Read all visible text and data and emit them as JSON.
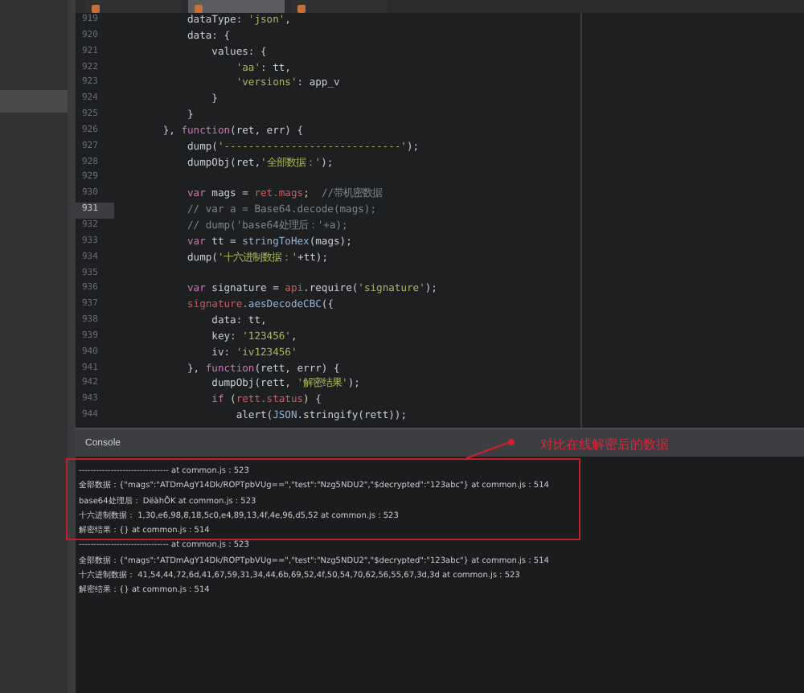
{
  "editor": {
    "tabs": [
      {
        "selected": false
      },
      {
        "selected": true
      },
      {
        "selected": false
      }
    ],
    "lines": [
      {
        "number": "919",
        "current": false,
        "tokens": [
          {
            "kind": "plain",
            "t": "            dataType: "
          },
          {
            "kind": "str",
            "t": "'json'"
          },
          {
            "kind": "plain",
            "t": ","
          }
        ]
      },
      {
        "number": "920",
        "current": false,
        "tokens": [
          {
            "kind": "plain",
            "t": "            data: {"
          }
        ]
      },
      {
        "number": "921",
        "current": false,
        "tokens": [
          {
            "kind": "plain",
            "t": "                values: {"
          }
        ]
      },
      {
        "number": "922",
        "current": false,
        "tokens": [
          {
            "kind": "str",
            "t": "                    'aa'"
          },
          {
            "kind": "plain",
            "t": ": tt,"
          }
        ]
      },
      {
        "number": "923",
        "current": false,
        "tokens": [
          {
            "kind": "str",
            "t": "                    'versions'"
          },
          {
            "kind": "plain",
            "t": ": app_v"
          }
        ]
      },
      {
        "number": "924",
        "current": false,
        "tokens": [
          {
            "kind": "plain",
            "t": "                }"
          }
        ]
      },
      {
        "number": "925",
        "current": false,
        "tokens": [
          {
            "kind": "plain",
            "t": "            }"
          }
        ]
      },
      {
        "number": "926",
        "current": false,
        "tokens": [
          {
            "kind": "plain",
            "t": "        }, "
          },
          {
            "kind": "kw",
            "t": "function"
          },
          {
            "kind": "plain",
            "t": "(ret, err) {"
          }
        ]
      },
      {
        "number": "927",
        "current": false,
        "tokens": [
          {
            "kind": "plain",
            "t": "            dump("
          },
          {
            "kind": "str",
            "t": "'-----------------------------'"
          },
          {
            "kind": "plain",
            "t": ");"
          }
        ]
      },
      {
        "number": "928",
        "current": false,
        "tokens": [
          {
            "kind": "plain",
            "t": "            dumpObj(ret,"
          },
          {
            "kind": "str",
            "t": "'全部数据：'"
          },
          {
            "kind": "plain",
            "t": ");"
          }
        ]
      },
      {
        "number": "929",
        "current": false
      },
      {
        "number": "930",
        "current": false,
        "tokens": [
          {
            "kind": "kw",
            "t": "            var"
          },
          {
            "kind": "plain",
            "t": " mags = "
          },
          {
            "kind": "ref",
            "t": "ret.mags"
          },
          {
            "kind": "plain",
            "t": ";  "
          },
          {
            "kind": "comment",
            "t": "//带机密数据"
          }
        ]
      },
      {
        "number": "931",
        "current": true,
        "tokens": [
          {
            "kind": "comment",
            "t": "            // var a = Base64.decode(mags);"
          }
        ]
      },
      {
        "number": "932",
        "current": false,
        "tokens": [
          {
            "kind": "comment",
            "t": "            // dump('base64处理后：'+a);"
          }
        ]
      },
      {
        "number": "933",
        "current": false,
        "tokens": [
          {
            "kind": "kw",
            "t": "            var"
          },
          {
            "kind": "plain",
            "t": " tt = "
          },
          {
            "kind": "fn",
            "t": "stringToHex"
          },
          {
            "kind": "plain",
            "t": "(mags);"
          }
        ]
      },
      {
        "number": "934",
        "current": false,
        "tokens": [
          {
            "kind": "plain",
            "t": "            dump("
          },
          {
            "kind": "str",
            "t": "'十六进制数据：'"
          },
          {
            "kind": "plain",
            "t": "+tt);"
          }
        ]
      },
      {
        "number": "935",
        "current": false
      },
      {
        "number": "936",
        "current": false,
        "tokens": [
          {
            "kind": "kw",
            "t": "            var"
          },
          {
            "kind": "plain",
            "t": " signature = "
          },
          {
            "kind": "ref",
            "t": "api"
          },
          {
            "kind": "plain",
            "t": ".require("
          },
          {
            "kind": "str",
            "t": "'signature'"
          },
          {
            "kind": "plain",
            "t": ");"
          }
        ]
      },
      {
        "number": "937",
        "current": false,
        "tokens": [
          {
            "kind": "ref",
            "t": "            signature"
          },
          {
            "kind": "fn",
            "t": ".aesDecodeCBC"
          },
          {
            "kind": "plain",
            "t": "({"
          }
        ]
      },
      {
        "number": "938",
        "current": false,
        "tokens": [
          {
            "kind": "plain",
            "t": "                data: tt,"
          }
        ]
      },
      {
        "number": "939",
        "current": false,
        "tokens": [
          {
            "kind": "plain",
            "t": "                key: "
          },
          {
            "kind": "str",
            "t": "'123456'"
          },
          {
            "kind": "plain",
            "t": ","
          }
        ]
      },
      {
        "number": "940",
        "current": false,
        "tokens": [
          {
            "kind": "plain",
            "t": "                iv: "
          },
          {
            "kind": "str",
            "t": "'iv123456'"
          }
        ]
      },
      {
        "number": "941",
        "current": false,
        "tokens": [
          {
            "kind": "plain",
            "t": "            }, "
          },
          {
            "kind": "kw",
            "t": "function"
          },
          {
            "kind": "plain",
            "t": "(rett, errr) {"
          }
        ]
      },
      {
        "number": "942",
        "current": false,
        "tokens": [
          {
            "kind": "plain",
            "t": "                dumpObj(rett, "
          },
          {
            "kind": "str",
            "t": "'解密结果'"
          },
          {
            "kind": "plain",
            "t": ");"
          }
        ]
      },
      {
        "number": "943",
        "current": false,
        "tokens": [
          {
            "kind": "kw",
            "t": "                if"
          },
          {
            "kind": "plain",
            "t": " ("
          },
          {
            "kind": "ref",
            "t": "rett.status"
          },
          {
            "kind": "plain",
            "t": ") {"
          }
        ]
      },
      {
        "number": "944",
        "current": false,
        "tokens": [
          {
            "kind": "plain",
            "t": "                    alert("
          },
          {
            "kind": "fn",
            "t": "JSON"
          },
          {
            "kind": "plain",
            "t": ".stringify(rett));"
          }
        ]
      }
    ]
  },
  "console": {
    "title": "Console",
    "lines": [
      "------------------------------- at common.js : 523",
      "全部数据：{\"mags\":\"ATDmAgY14Dk/ROPTpbVUg==\",\"test\":\"Nzg5NDU2\",\"$decrypted\":\"123abc\"} at common.js : 514",
      "base64处理后： DëàhÕK at common.js : 523",
      "十六进制数据： 1,30,e6,98,8,18,5c0,e4,89,13,4f,4e,96,d5,52 at common.js : 523",
      "解密结果：{} at common.js : 514",
      "------------------------------- at common.js : 523",
      "全部数据：{\"mags\":\"ATDmAgY14Dk/ROPTpbVUg==\",\"test\":\"Nzg5NDU2\",\"$decrypted\":\"123abc\"} at common.js : 514",
      "十六进制数据： 41,54,44,72,6d,41,67,59,31,34,44,6b,69,52,4f,50,54,70,62,56,55,67,3d,3d at common.js : 523",
      "解密结果：{} at common.js : 514"
    ]
  },
  "annotation": {
    "label": "对比在线解密后的数据"
  }
}
